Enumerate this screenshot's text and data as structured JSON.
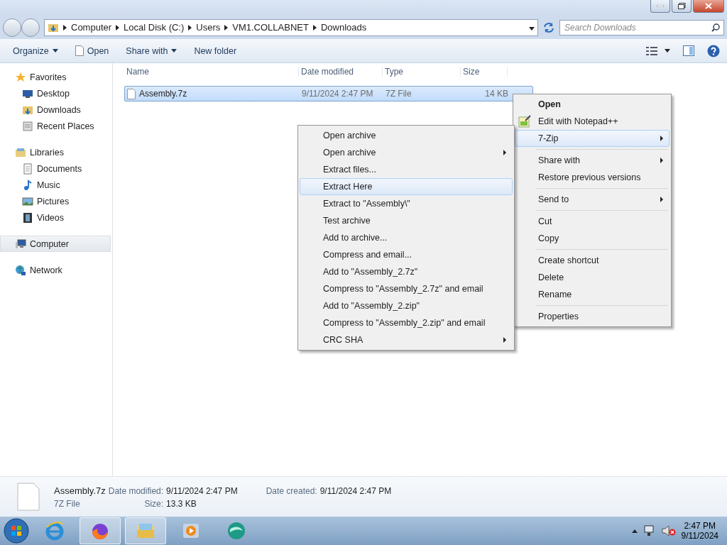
{
  "address_bar": {
    "crumbs": [
      "Computer",
      "Local Disk (C:)",
      "Users",
      "VM1.COLLABNET",
      "Downloads"
    ],
    "search_placeholder": "Search Downloads"
  },
  "toolbar": {
    "buttons": [
      {
        "label": "Organize",
        "dropdown": true,
        "kind": "menu"
      },
      {
        "label": "Open",
        "dropdown": false,
        "kind": "open"
      },
      {
        "label": "Share with",
        "dropdown": true,
        "kind": "menu"
      },
      {
        "label": "New folder",
        "dropdown": false,
        "kind": "plain"
      }
    ]
  },
  "sidebar": {
    "groups": [
      {
        "label": "Favorites",
        "kind": "star",
        "selected": false,
        "children": [
          {
            "label": "Desktop",
            "kind": "desktop",
            "selected": false
          },
          {
            "label": "Downloads",
            "kind": "downloads",
            "selected": false
          },
          {
            "label": "Recent Places",
            "kind": "recent",
            "selected": false
          }
        ]
      },
      {
        "label": "Libraries",
        "kind": "libraries",
        "selected": false,
        "children": [
          {
            "label": "Documents",
            "kind": "documents",
            "selected": false
          },
          {
            "label": "Music",
            "kind": "music",
            "selected": false
          },
          {
            "label": "Pictures",
            "kind": "pictures",
            "selected": false
          },
          {
            "label": "Videos",
            "kind": "videos",
            "selected": false
          }
        ]
      },
      {
        "label": "Computer",
        "kind": "computer",
        "selected": true
      },
      {
        "label": "Network",
        "kind": "network",
        "selected": false
      }
    ]
  },
  "file_list": {
    "columns": [
      "Name",
      "Date modified",
      "Type",
      "Size"
    ],
    "rows": [
      {
        "name": "Assembly.7z",
        "date_modified": "9/11/2024 2:47 PM",
        "type": "7Z File",
        "size": "14 KB",
        "selected": true
      }
    ]
  },
  "context_menu": {
    "groups": [
      [
        {
          "label": "Open",
          "default": true,
          "has_icon": false,
          "submenu": false,
          "highlighted": false
        },
        {
          "label": "Edit with Notepad++",
          "default": false,
          "has_icon": true,
          "submenu": false,
          "highlighted": false
        },
        {
          "label": "7-Zip",
          "default": false,
          "has_icon": false,
          "submenu": true,
          "highlighted": true
        }
      ],
      [
        {
          "label": "Share with",
          "default": false,
          "has_icon": false,
          "submenu": true,
          "highlighted": false
        },
        {
          "label": "Restore previous versions",
          "default": false,
          "has_icon": false,
          "submenu": false,
          "highlighted": false
        }
      ],
      [
        {
          "label": "Send to",
          "default": false,
          "has_icon": false,
          "submenu": true,
          "highlighted": false
        }
      ],
      [
        {
          "label": "Cut",
          "default": false,
          "has_icon": false,
          "submenu": false,
          "highlighted": false
        },
        {
          "label": "Copy",
          "default": false,
          "has_icon": false,
          "submenu": false,
          "highlighted": false
        }
      ],
      [
        {
          "label": "Create shortcut",
          "default": false,
          "has_icon": false,
          "submenu": false,
          "highlighted": false
        },
        {
          "label": "Delete",
          "default": false,
          "has_icon": false,
          "submenu": false,
          "highlighted": false
        },
        {
          "label": "Rename",
          "default": false,
          "has_icon": false,
          "submenu": false,
          "highlighted": false
        }
      ],
      [
        {
          "label": "Properties",
          "default": false,
          "has_icon": false,
          "submenu": false,
          "highlighted": false
        }
      ]
    ]
  },
  "submenu": {
    "items": [
      {
        "label": "Open archive",
        "submenu": false,
        "highlighted": false
      },
      {
        "label": "Open archive",
        "submenu": true,
        "highlighted": false
      },
      {
        "label": "Extract files...",
        "submenu": false,
        "highlighted": false
      },
      {
        "label": "Extract Here",
        "submenu": false,
        "highlighted": true
      },
      {
        "label": "Extract to \"Assembly\\\"",
        "submenu": false,
        "highlighted": false
      },
      {
        "label": "Test archive",
        "submenu": false,
        "highlighted": false
      },
      {
        "label": "Add to archive...",
        "submenu": false,
        "highlighted": false
      },
      {
        "label": "Compress and email...",
        "submenu": false,
        "highlighted": false
      },
      {
        "label": "Add to \"Assembly_2.7z\"",
        "submenu": false,
        "highlighted": false
      },
      {
        "label": "Compress to \"Assembly_2.7z\" and email",
        "submenu": false,
        "highlighted": false
      },
      {
        "label": "Add to \"Assembly_2.zip\"",
        "submenu": false,
        "highlighted": false
      },
      {
        "label": "Compress to \"Assembly_2.zip\" and email",
        "submenu": false,
        "highlighted": false
      },
      {
        "label": "CRC SHA",
        "submenu": true,
        "highlighted": false
      }
    ]
  },
  "details_pane": {
    "name": "Assembly.7z",
    "type": "7Z File",
    "fields": [
      {
        "label": "Date modified:",
        "value": "9/11/2024 2:47 PM"
      },
      {
        "label": "Size:",
        "value": "13.3 KB"
      },
      {
        "label": "Date created:",
        "value": "9/11/2024 2:47 PM"
      }
    ]
  },
  "taskbar": {
    "apps": [
      {
        "kind": "ie",
        "active": false
      },
      {
        "kind": "firefox",
        "active": true
      },
      {
        "kind": "explorer",
        "active": true
      },
      {
        "kind": "media",
        "active": false
      },
      {
        "kind": "teal",
        "active": false
      }
    ],
    "clock": {
      "time": "2:47 PM",
      "date": "9/11/2024"
    }
  }
}
